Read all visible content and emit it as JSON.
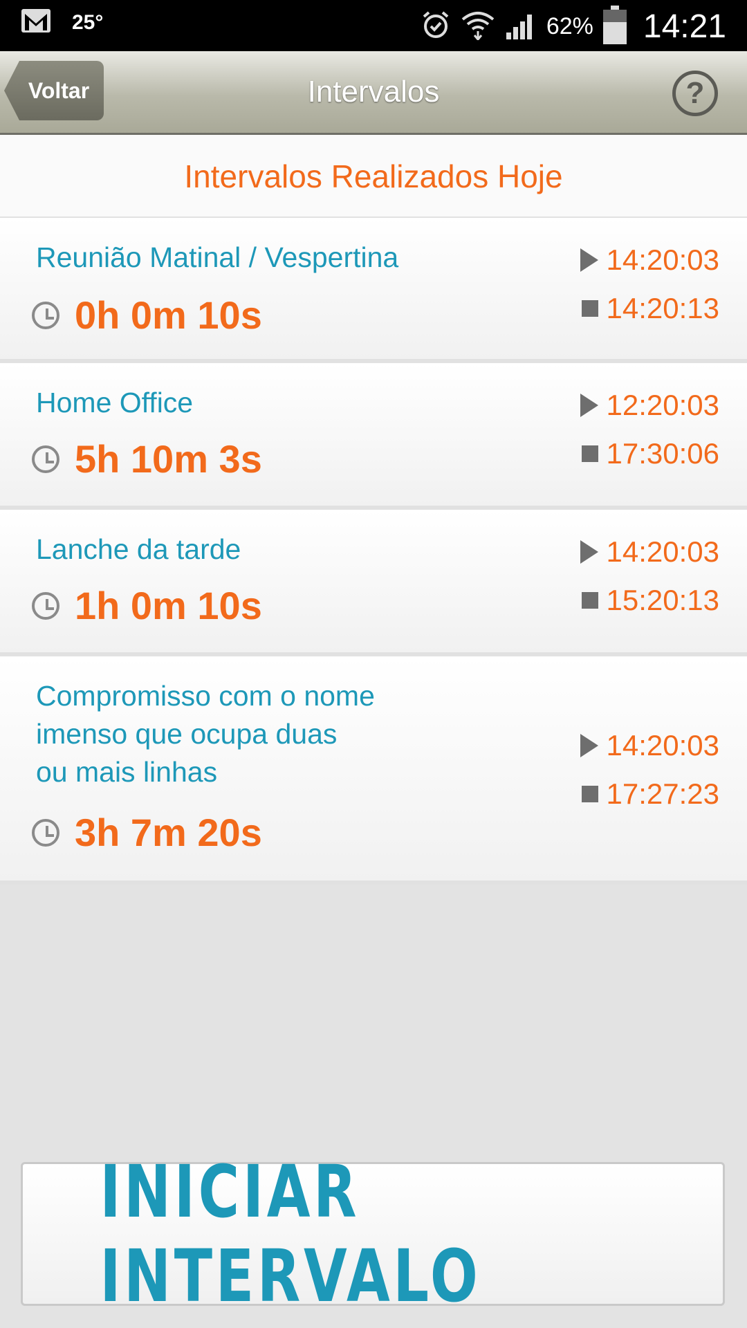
{
  "status_bar": {
    "temperature": "25°",
    "battery_pct": "62%",
    "time": "14:21",
    "icons": [
      "gmail-icon",
      "alarm-icon",
      "wifi-icon",
      "signal-icon",
      "battery-icon"
    ]
  },
  "header": {
    "back_label": "Voltar",
    "title": "Intervalos",
    "help_label": "?"
  },
  "section": {
    "title": "Intervalos Realizados Hoje"
  },
  "intervals": [
    {
      "name": "Reunião Matinal / Vespertina",
      "duration": "0h 0m 10s",
      "start": "14:20:03",
      "end": "14:20:13"
    },
    {
      "name": "Home Office",
      "duration": "5h 10m 3s",
      "start": "12:20:03",
      "end": "17:30:06"
    },
    {
      "name": "Lanche da tarde",
      "duration": "1h 0m 10s",
      "start": "14:20:03",
      "end": "15:20:13"
    },
    {
      "name": "Compromisso com o nome\nimenso que ocupa duas\nou mais linhas",
      "duration": "3h 7m 20s",
      "start": "14:20:03",
      "end": "17:27:23"
    }
  ],
  "action": {
    "start_label": "INICIAR INTERVALO"
  },
  "colors": {
    "accent_orange": "#f26a1b",
    "accent_blue": "#1d98b8"
  }
}
